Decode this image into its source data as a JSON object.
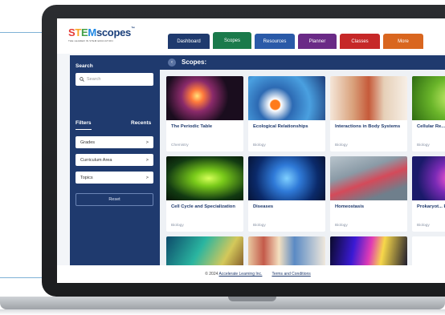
{
  "logo": {
    "part_s": "S",
    "part_t": "T",
    "part_e": "E",
    "part_m": "M",
    "part_rest": "scopes",
    "tm": "™",
    "tagline": "THE LEADER IN STEM EDUCATION"
  },
  "nav": [
    {
      "label": "Dashboard",
      "color": "#1f3a6e"
    },
    {
      "label": "Scopes",
      "color": "#1b7a4b"
    },
    {
      "label": "Resources",
      "color": "#2a5aa8"
    },
    {
      "label": "Planner",
      "color": "#6a2a86"
    },
    {
      "label": "Classes",
      "color": "#c62828"
    },
    {
      "label": "More",
      "color": "#d9661f"
    }
  ],
  "sidebar": {
    "search_label": "Search",
    "search_placeholder": "Search",
    "filters_label": "Filters",
    "recents_label": "Recents",
    "filters": [
      {
        "label": "Grades",
        "chevron": ">"
      },
      {
        "label": "Curriculum Area",
        "chevron": ">"
      },
      {
        "label": "Topics",
        "chevron": ">"
      }
    ],
    "reset_label": "Reset"
  },
  "main": {
    "back_icon": "‹",
    "title": "Scopes:",
    "cards": [
      {
        "title": "The Periodic Table",
        "subject": "Chemistry",
        "img": "fireworks"
      },
      {
        "title": "Ecological Relationships",
        "subject": "Biology",
        "img": "anemone"
      },
      {
        "title": "Interactions in Body Systems",
        "subject": "Biology",
        "img": "anatomy"
      },
      {
        "title": "Cellular Re... Photosynt...",
        "subject": "Biology",
        "img": "leaf"
      },
      {
        "title": "Cell Cycle and Specialization",
        "subject": "Biology",
        "img": "dna"
      },
      {
        "title": "Diseases",
        "subject": "Biology",
        "img": "virus"
      },
      {
        "title": "Homeostasis",
        "subject": "Biology",
        "img": "cell"
      },
      {
        "title": "Prokaryot... Eukaryotic...",
        "subject": "Biology",
        "img": "bacteria"
      },
      {
        "title": "",
        "subject": "",
        "img": "circuit"
      },
      {
        "title": "",
        "subject": "",
        "img": "lab"
      },
      {
        "title": "",
        "subject": "",
        "img": "prism"
      },
      {
        "title": "",
        "subject": "",
        "img": "blank"
      }
    ]
  },
  "footer": {
    "copyright": "© 2024",
    "company": "Accelerate Learning Inc.",
    "terms": "Terms and Conditions"
  }
}
